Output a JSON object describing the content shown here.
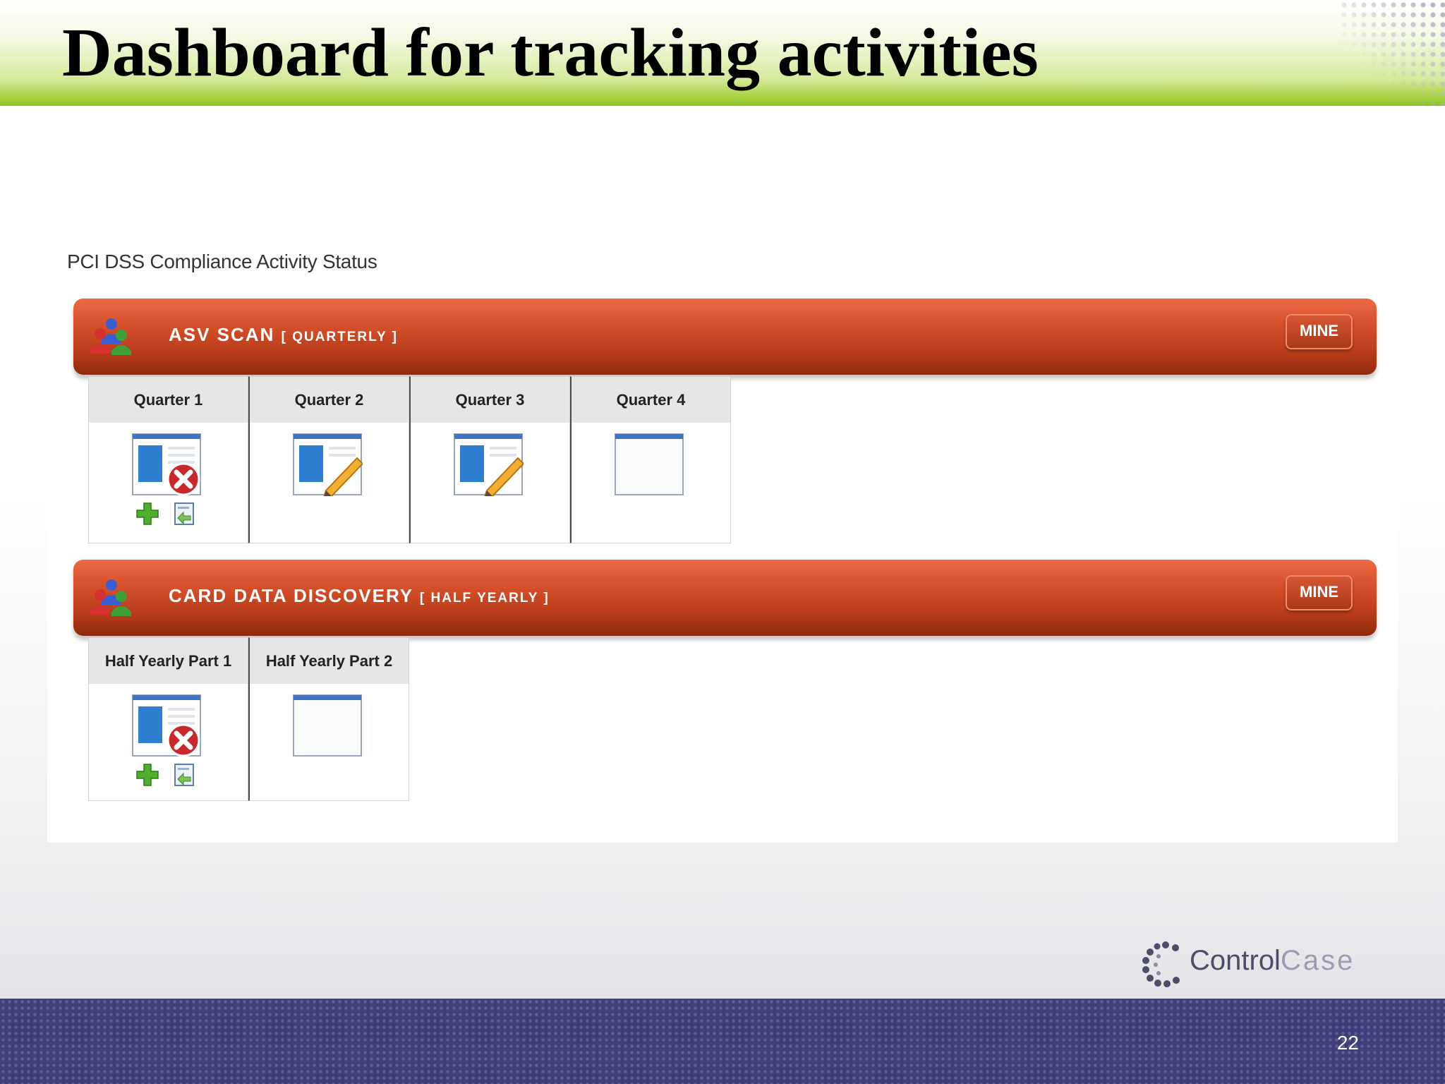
{
  "slide": {
    "title": "Dashboard for tracking activities",
    "page_number": "22"
  },
  "panel": {
    "title": "PCI DSS Compliance Activity Status"
  },
  "activities": [
    {
      "name": "ASV SCAN",
      "frequency": "[ QUARTERLY ]",
      "mine_label": "MINE",
      "columns": [
        {
          "label": "Quarter 1",
          "icon": "document-error-icon",
          "has_actions": true
        },
        {
          "label": "Quarter 2",
          "icon": "document-edit-icon",
          "has_actions": false
        },
        {
          "label": "Quarter 3",
          "icon": "document-edit-icon",
          "has_actions": false
        },
        {
          "label": "Quarter 4",
          "icon": "document-blank-icon",
          "has_actions": false
        }
      ]
    },
    {
      "name": "CARD DATA DISCOVERY",
      "frequency": "[ HALF YEARLY ]",
      "mine_label": "MINE",
      "columns": [
        {
          "label": "Half Yearly Part 1",
          "icon": "document-error-icon",
          "has_actions": true
        },
        {
          "label": "Half Yearly Part 2",
          "icon": "document-blank-icon",
          "has_actions": false
        }
      ]
    }
  ],
  "logo": {
    "part1": "Control",
    "part2": "Case"
  },
  "colors": {
    "bar": "#c8461f",
    "title_band_green": "#a6d13e",
    "footer_band": "#3f3d78",
    "error_red": "#c8282a",
    "add_green": "#4fae2d"
  }
}
